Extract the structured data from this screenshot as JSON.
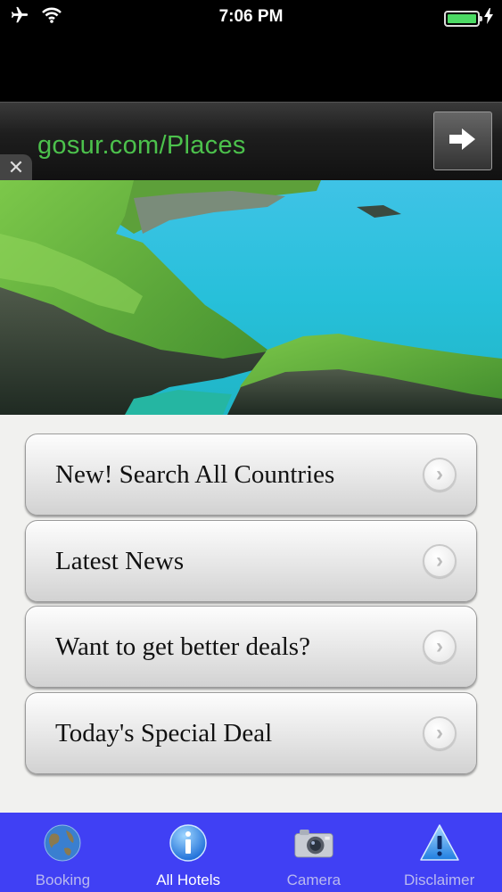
{
  "status_bar": {
    "time": "7:06 PM",
    "icons": [
      "airplane-icon",
      "wifi-icon",
      "battery-icon",
      "charging-bolt-icon"
    ],
    "battery_level": 1.0
  },
  "ad": {
    "url_text": "gosur.com/Places",
    "close_symbol": "✕",
    "go_icon": "arrow-right-icon"
  },
  "hero": {
    "image": "coastal-cliffs-photo"
  },
  "menu": {
    "items": [
      {
        "label": "New! Search All Countries"
      },
      {
        "label": "Latest News"
      },
      {
        "label": "Want to get better deals?"
      },
      {
        "label": "Today's Special Deal"
      }
    ],
    "chevron_symbol": "›"
  },
  "tab_bar": {
    "accent_color": "#4040f4",
    "tabs": [
      {
        "label": "Booking",
        "icon": "globe-icon",
        "active": false
      },
      {
        "label": "All Hotels",
        "icon": "info-icon",
        "active": true
      },
      {
        "label": "Camera",
        "icon": "camera-icon",
        "active": false
      },
      {
        "label": "Disclaimer",
        "icon": "warning-icon",
        "active": false
      }
    ]
  }
}
